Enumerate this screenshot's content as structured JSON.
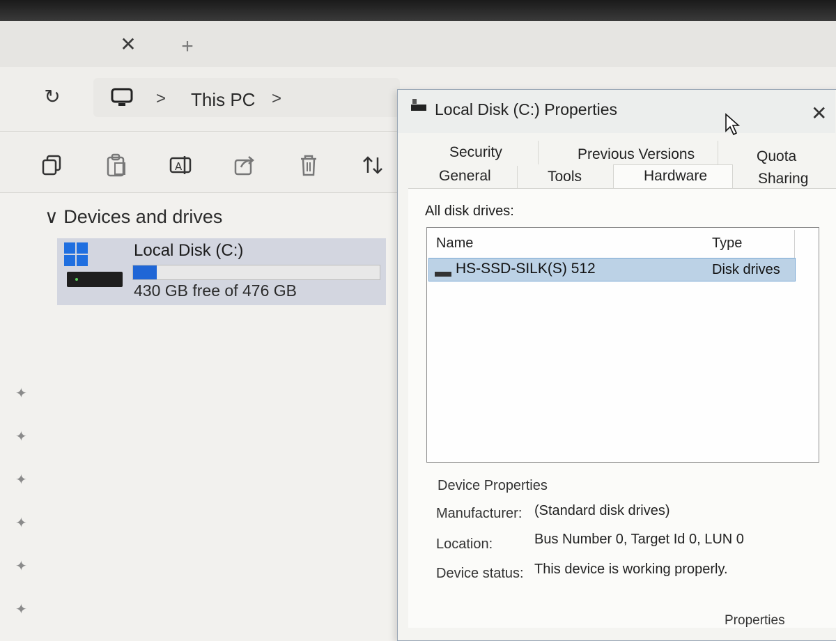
{
  "explorer": {
    "breadcrumb": {
      "location": "This PC",
      "chevron": ">"
    },
    "toolbar": {
      "icons": [
        "copy-icon",
        "paste-icon",
        "rename-icon",
        "share-icon",
        "delete-icon",
        "sort-icon"
      ]
    },
    "section": {
      "title": "Devices and drives",
      "chevron": "∨"
    },
    "drives": [
      {
        "name": "Local Disk (C:)",
        "free_text": "430 GB free of 476 GB",
        "used_fraction": 0.097
      }
    ]
  },
  "dialog": {
    "title": "Local Disk (C:) Properties",
    "close": "✕",
    "tabs_back": [
      "Security",
      "Previous Versions",
      "Quota"
    ],
    "tabs_front": [
      "General",
      "Tools",
      "Hardware",
      "Sharing"
    ],
    "active_tab": "Hardware",
    "list_label": "All disk drives:",
    "columns": {
      "name": "Name",
      "type": "Type"
    },
    "disks": [
      {
        "name": "HS-SSD-SILK(S) 512",
        "type": "Disk drives"
      }
    ],
    "device_properties": {
      "heading": "Device Properties",
      "manufacturer_label": "Manufacturer:",
      "manufacturer": "(Standard disk drives)",
      "location_label": "Location:",
      "location": "Bus Number 0, Target Id 0, LUN 0",
      "status_label": "Device status:",
      "status": "This device is working properly."
    },
    "properties_button": "Properties"
  },
  "colors": {
    "accent": "#1f66d6",
    "selection": "#bcd2e6",
    "tile": "#d3d6e0"
  }
}
